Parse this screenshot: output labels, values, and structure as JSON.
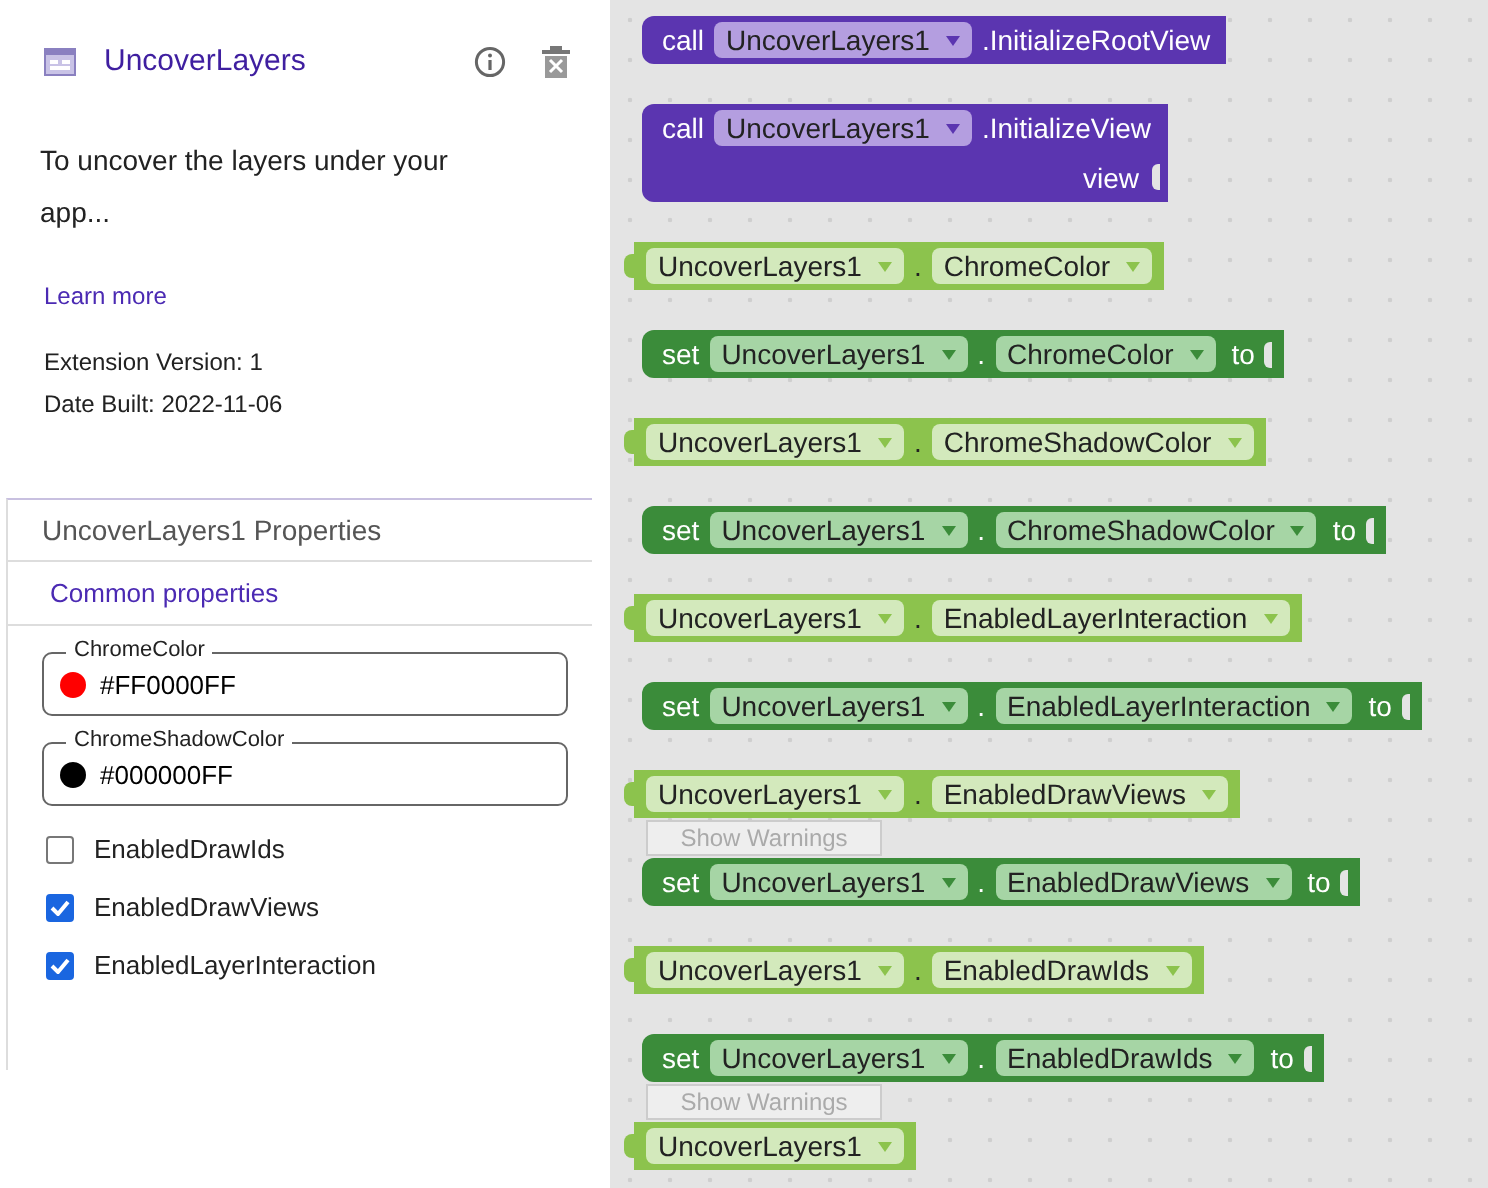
{
  "extension": {
    "title": "UncoverLayers",
    "description": "To uncover the layers under your app...",
    "learn_more": "Learn more",
    "version": "Extension Version: 1",
    "date_built": "Date Built: 2022-11-06"
  },
  "properties": {
    "title": "UncoverLayers1 Properties",
    "section": "Common properties",
    "color_fields": [
      {
        "label": "ChromeColor",
        "value": "#FF0000FF",
        "color": "#ff0000"
      },
      {
        "label": "ChromeShadowColor",
        "value": "#000000FF",
        "color": "#000000"
      }
    ],
    "checkboxes": [
      {
        "label": "EnabledDrawIds",
        "checked": false
      },
      {
        "label": "EnabledDrawViews",
        "checked": true
      },
      {
        "label": "EnabledLayerInteraction",
        "checked": true
      }
    ]
  },
  "workspace": {
    "blocks": [
      {
        "kind": "call",
        "keyword": "call",
        "component": "UncoverLayers1",
        "member": ".InitializeRootView"
      },
      {
        "kind": "call",
        "keyword": "call",
        "component": "UncoverLayers1",
        "member": ".InitializeView",
        "arg": "view"
      },
      {
        "kind": "getter",
        "component": "UncoverLayers1",
        "dot": ".",
        "member": "ChromeColor"
      },
      {
        "kind": "setter",
        "keyword": "set",
        "component": "UncoverLayers1",
        "dot": ".",
        "member": "ChromeColor",
        "to": "to"
      },
      {
        "kind": "getter",
        "component": "UncoverLayers1",
        "dot": ".",
        "member": "ChromeShadowColor"
      },
      {
        "kind": "setter",
        "keyword": "set",
        "component": "UncoverLayers1",
        "dot": ".",
        "member": "ChromeShadowColor",
        "to": "to"
      },
      {
        "kind": "getter",
        "component": "UncoverLayers1",
        "dot": ".",
        "member": "EnabledLayerInteraction"
      },
      {
        "kind": "setter",
        "keyword": "set",
        "component": "UncoverLayers1",
        "dot": ".",
        "member": "EnabledLayerInteraction",
        "to": "to"
      },
      {
        "kind": "getter",
        "component": "UncoverLayers1",
        "dot": ".",
        "member": "EnabledDrawViews"
      },
      {
        "kind": "setter",
        "keyword": "set",
        "component": "UncoverLayers1",
        "dot": ".",
        "member": "EnabledDrawViews",
        "to": "to"
      },
      {
        "kind": "getter",
        "component": "UncoverLayers1",
        "dot": ".",
        "member": "EnabledDrawIds"
      },
      {
        "kind": "setter",
        "keyword": "set",
        "component": "UncoverLayers1",
        "dot": ".",
        "member": "EnabledDrawIds",
        "to": "to"
      },
      {
        "kind": "getter",
        "component": "UncoverLayers1"
      }
    ],
    "warning_buttons": [
      {
        "label": "Show Warnings"
      },
      {
        "label": "Show Warnings"
      }
    ]
  }
}
